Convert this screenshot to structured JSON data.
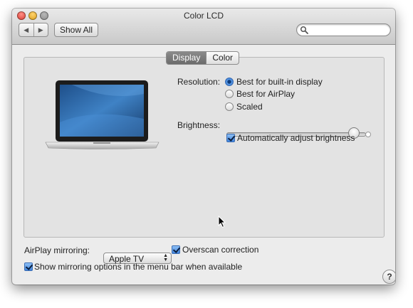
{
  "window": {
    "title": "Color LCD"
  },
  "toolbar": {
    "back_glyph": "◀",
    "forward_glyph": "▶",
    "show_all_label": "Show All",
    "search": {
      "value": "",
      "placeholder": ""
    }
  },
  "tabs": [
    {
      "label": "Display",
      "selected": true
    },
    {
      "label": "Color",
      "selected": false
    }
  ],
  "display": {
    "resolution_label": "Resolution:",
    "resolution_options": [
      {
        "label": "Best for built-in display",
        "selected": true
      },
      {
        "label": "Best for AirPlay",
        "selected": false
      },
      {
        "label": "Scaled",
        "selected": false
      }
    ],
    "brightness_label": "Brightness:",
    "brightness_level": 0.95,
    "auto_brightness": {
      "label": "Automatically adjust brightness",
      "checked": true
    }
  },
  "airplay": {
    "mirroring_label": "AirPlay mirroring:",
    "mirroring_value": "Apple TV",
    "overscan": {
      "label": "Overscan correction",
      "checked": true
    },
    "menu_bar_option": {
      "label": "Show mirroring options in the menu bar when available",
      "checked": true
    }
  },
  "help": {
    "glyph": "?"
  },
  "icons": [
    "close-icon",
    "minimize-icon",
    "zoom-icon",
    "back-arrow-icon",
    "forward-arrow-icon",
    "search-icon",
    "laptop-icon",
    "help-icon",
    "mouse-cursor-icon"
  ]
}
